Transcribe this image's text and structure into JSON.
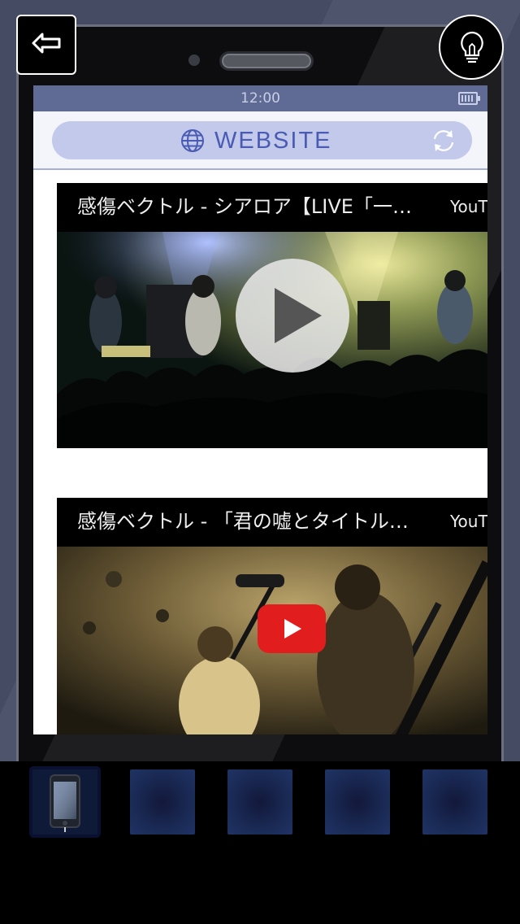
{
  "phone": {
    "status_bar": {
      "time": "12:00",
      "battery_icon": "battery-icon"
    },
    "url_bar": {
      "icon": "globe-icon",
      "text": "WEBSITE",
      "reload_icon": "reload-icon"
    },
    "videos": [
      {
        "title": "感傷ベクトル - シアロア【LIVE「一…",
        "source": "YouT",
        "overlay_icon": "play-circle-icon"
      },
      {
        "title": "感傷ベクトル - 「君の嘘とタイトル…",
        "source": "YouT",
        "overlay_icon": "youtube-play-icon"
      }
    ]
  },
  "toolbar": {
    "back_icon": "back-arrow-icon",
    "hint_icon": "lightbulb-icon"
  },
  "inventory": {
    "selected_index": 0,
    "slots": [
      {
        "item_icon": "smartphone-icon"
      },
      {
        "item_icon": ""
      },
      {
        "item_icon": ""
      },
      {
        "item_icon": ""
      },
      {
        "item_icon": ""
      }
    ]
  },
  "colors": {
    "background": "#454b63",
    "status_bar": "#5f6a95",
    "url_bar": "#c2c9eb",
    "url_text": "#4a5bb4",
    "youtube_red": "#e21d1d"
  }
}
